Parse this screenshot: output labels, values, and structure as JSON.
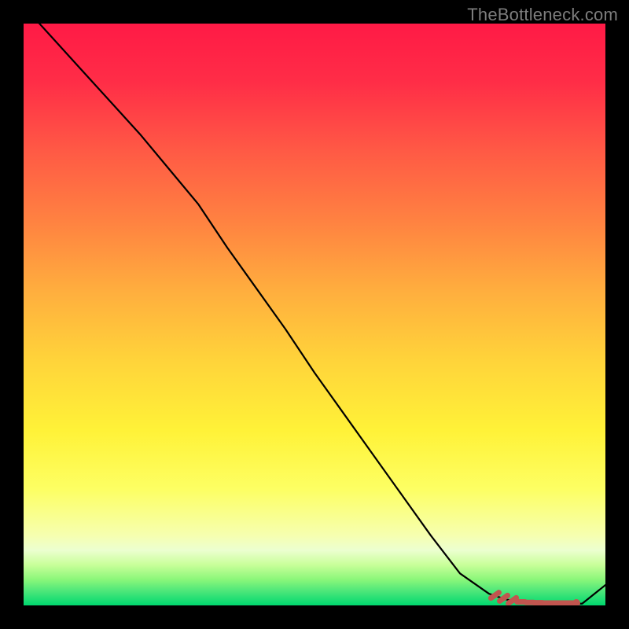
{
  "watermark": "TheBottleneck.com",
  "colors": {
    "background": "#000000",
    "gradient_top": "#ff1744",
    "gradient_mid_upper": "#ff7a3c",
    "gradient_mid": "#ffe63a",
    "gradient_lower": "#fdff8a",
    "gradient_band": "#b6ff6e",
    "gradient_bottom": "#00e676",
    "curve": "#000000",
    "marker_stroke": "#c1554f",
    "marker_fill": "#c1554f"
  },
  "chart_data": {
    "type": "line",
    "title": "",
    "xlabel": "",
    "ylabel": "",
    "xlim": [
      0,
      100
    ],
    "ylim": [
      0,
      100
    ],
    "grid": false,
    "legend": false,
    "series": [
      {
        "name": "bottleneck-curve",
        "x": [
          0,
          5,
          10,
          15,
          20,
          25,
          30,
          35,
          40,
          45,
          50,
          55,
          60,
          65,
          70,
          75,
          80,
          83,
          86,
          88,
          90,
          92,
          94,
          96,
          100
        ],
        "y": [
          103,
          97.5,
          92,
          86.5,
          81,
          75,
          69,
          61.5,
          54.5,
          47.5,
          40,
          33,
          26,
          19,
          12,
          5.5,
          2,
          1,
          0.5,
          0.3,
          0.3,
          0.3,
          0.3,
          0.3,
          3.5
        ]
      }
    ],
    "markers": {
      "name": "highlighted-range",
      "x": [
        81,
        82.5,
        84,
        85.5,
        87,
        88.5,
        90,
        91.5,
        93,
        94,
        95
      ],
      "y": [
        1.8,
        1.3,
        0.9,
        0.6,
        0.5,
        0.45,
        0.4,
        0.4,
        0.4,
        0.4,
        0.4
      ]
    }
  }
}
